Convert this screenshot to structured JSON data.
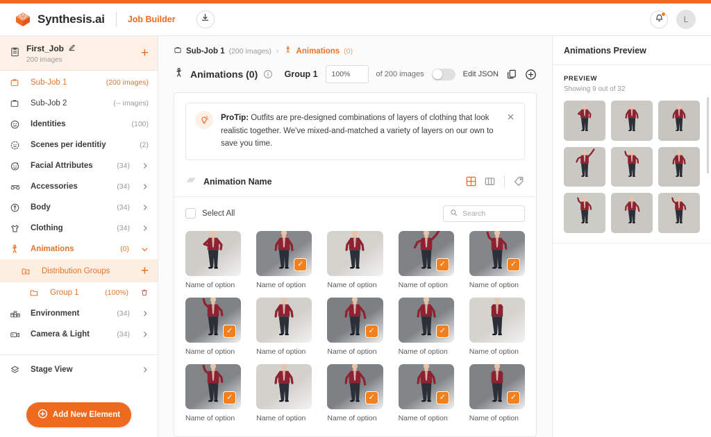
{
  "header": {
    "brand": "Synthesis.ai",
    "product": "Job Builder",
    "download_icon": "download-icon",
    "bell_icon": "bell-icon",
    "avatar_initial": "L"
  },
  "sidebar": {
    "job": {
      "title": "First_Job",
      "subtitle": "200 images",
      "edit_icon": "pencil-icon",
      "add_label": "+"
    },
    "items": [
      {
        "label": "Sub-Job 1",
        "count": "(200 images)",
        "icon": "briefcase-icon",
        "state": "active",
        "bold": false,
        "chevron": false
      },
      {
        "label": "Sub-Job 2",
        "count": "(-- images)",
        "icon": "briefcase-icon",
        "state": "normal",
        "bold": false,
        "chevron": false
      },
      {
        "label": "Identities",
        "count": "(100)",
        "icon": "identity-icon",
        "state": "normal",
        "bold": true,
        "chevron": false
      },
      {
        "label": "Scenes per identitiy",
        "count": "(2)",
        "icon": "scenes-icon",
        "state": "normal",
        "bold": true,
        "chevron": false
      },
      {
        "label": "Facial Attributes",
        "count": "(34)",
        "icon": "face-icon",
        "state": "normal",
        "bold": true,
        "chevron": true
      },
      {
        "label": "Accessories",
        "count": "(34)",
        "icon": "glasses-icon",
        "state": "normal",
        "bold": true,
        "chevron": true
      },
      {
        "label": "Body",
        "count": "(34)",
        "icon": "body-icon",
        "state": "normal",
        "bold": true,
        "chevron": true
      },
      {
        "label": "Clothing",
        "count": "(34)",
        "icon": "shirt-icon",
        "state": "normal",
        "bold": true,
        "chevron": true
      },
      {
        "label": "Animations",
        "count": "(0)",
        "icon": "animation-icon",
        "state": "selected",
        "bold": true,
        "chevron": "down"
      }
    ],
    "distribution_groups": {
      "label": "Distribution Groups",
      "icon": "folder-plus-icon",
      "add_label": "+"
    },
    "group": {
      "label": "Group 1",
      "count": "(100%)",
      "icon": "folder-icon",
      "delete_icon": "trash-icon"
    },
    "items_after": [
      {
        "label": "Environment",
        "count": "(34)",
        "icon": "environment-icon",
        "bold": true,
        "chevron": true
      },
      {
        "label": "Camera & Light",
        "count": "(34)",
        "icon": "camera-icon",
        "bold": true,
        "chevron": true
      }
    ],
    "stage_view": {
      "label": "Stage View",
      "icon": "layers-icon"
    },
    "add_new_element": {
      "label": "Add New Element",
      "icon": "plus-circle-icon"
    }
  },
  "breadcrumb": {
    "sub_job": "Sub-Job 1",
    "sub_job_count": "(200 images)",
    "separator": "›",
    "current": "Animations",
    "current_count": "(0)"
  },
  "toolbar": {
    "title": "Animations (0)",
    "info_icon": "info-icon",
    "group_label": "Group 1",
    "percent_value": "100%",
    "percent_placeholder": "100%",
    "of_images": "of 200 images",
    "edit_json_label": "Edit JSON",
    "copy_icon": "copy-icon",
    "add_icon": "plus-circle-icon",
    "toggle_on": false
  },
  "protip": {
    "icon": "lightbulb-icon",
    "label": "ProTip:",
    "text": " Outfits are pre-designed combinations of layers of clothing that look realistic together. We've mixed-and-matched a variety of layers on our own to save you time.",
    "close_icon": "close-icon"
  },
  "section": {
    "icon": "pattern-icon",
    "title": "Animation Name",
    "grid_view_icon": "grid-view-icon",
    "column_view_icon": "column-view-icon",
    "tag_icon": "tag-icon"
  },
  "select_row": {
    "select_all_label": "Select All",
    "checked": false,
    "search_placeholder": "Search",
    "search_value": "",
    "search_icon": "search-icon"
  },
  "grid": {
    "item_label": "Name of option",
    "check_glyph": "✓",
    "tiles": [
      {
        "label": "Name of option",
        "checked": false,
        "bg": "#cfcdc8",
        "pose": "hand-on-hip"
      },
      {
        "label": "Name of option",
        "checked": true,
        "bg": "#85898c",
        "pose": "stand"
      },
      {
        "label": "Name of option",
        "checked": false,
        "bg": "#d4d2cd",
        "pose": "stand"
      },
      {
        "label": "Name of option",
        "checked": true,
        "bg": "#7e8285",
        "pose": "arm-up"
      },
      {
        "label": "Name of option",
        "checked": true,
        "bg": "#83878a",
        "pose": "wave"
      },
      {
        "label": "Name of option",
        "checked": true,
        "bg": "#7f8386",
        "pose": "wave"
      },
      {
        "label": "Name of option",
        "checked": false,
        "bg": "#d2d0cb",
        "pose": "stand"
      },
      {
        "label": "Name of option",
        "checked": true,
        "bg": "#7c8083",
        "pose": "point-down"
      },
      {
        "label": "Name of option",
        "checked": true,
        "bg": "#808487",
        "pose": "stand"
      },
      {
        "label": "Name of option",
        "checked": false,
        "bg": "#d5d3ce",
        "pose": "arms-crossed"
      },
      {
        "label": "Name of option",
        "checked": true,
        "bg": "#818588",
        "pose": "wave"
      },
      {
        "label": "Name of option",
        "checked": false,
        "bg": "#d3d1cc",
        "pose": "stand"
      },
      {
        "label": "Name of option",
        "checked": true,
        "bg": "#7d8184",
        "pose": "point-down"
      },
      {
        "label": "Name of option",
        "checked": true,
        "bg": "#828689",
        "pose": "stand"
      },
      {
        "label": "Name of option",
        "checked": true,
        "bg": "#7e8285",
        "pose": "arms-crossed"
      }
    ]
  },
  "preview_panel": {
    "title": "Animations Preview",
    "kicker": "PREVIEW",
    "showing": "Showing 9 out of 32",
    "thumbs": [
      {
        "bg": "#c9c7c2",
        "pose": "hand-on-hip"
      },
      {
        "bg": "#cbc9c4",
        "pose": "stand"
      },
      {
        "bg": "#c7c5c0",
        "pose": "stand"
      },
      {
        "bg": "#cac8c3",
        "pose": "arm-up"
      },
      {
        "bg": "#cdcbc6",
        "pose": "wave"
      },
      {
        "bg": "#c8c6c1",
        "pose": "stand"
      },
      {
        "bg": "#ccccc7",
        "pose": "wave"
      },
      {
        "bg": "#c9c7c2",
        "pose": "point-down"
      },
      {
        "bg": "#cbc9c4",
        "pose": "wave"
      }
    ]
  },
  "colors": {
    "accent": "#ee6a1e",
    "accent_soft": "#fdf0e6",
    "check_orange": "#f2801f",
    "text_dark": "#2e2e2e",
    "text_muted": "#9a9a9a"
  }
}
